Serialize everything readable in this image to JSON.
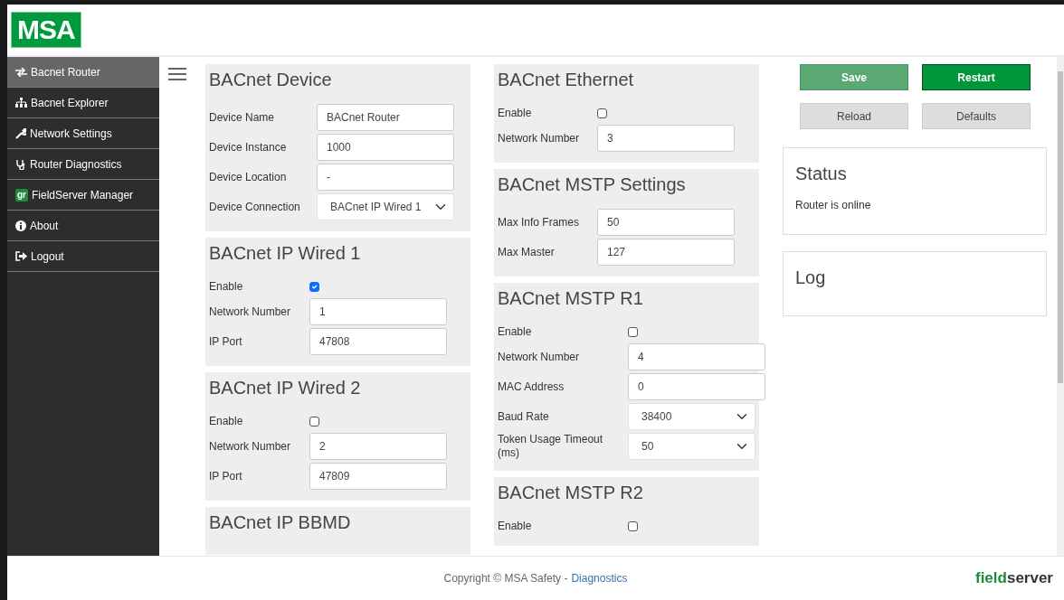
{
  "header": {
    "logo": "MSA"
  },
  "sidebar": {
    "items": [
      {
        "label": "Bacnet Router",
        "selected": true
      },
      {
        "label": "Bacnet Explorer",
        "selected": false
      },
      {
        "label": "Network Settings",
        "selected": false
      },
      {
        "label": "Router Diagnostics",
        "selected": false
      },
      {
        "label": "FieldServer Manager",
        "selected": false,
        "badge": "gr"
      },
      {
        "label": "About",
        "selected": false
      },
      {
        "label": "Logout",
        "selected": false
      }
    ]
  },
  "columns": [
    [
      {
        "title": "BACnet Device",
        "fields": [
          {
            "label": "Device Name",
            "kind": "text",
            "value": "BACnet Router"
          },
          {
            "label": "Device Instance",
            "kind": "text",
            "value": "1000"
          },
          {
            "label": "Device Location",
            "kind": "text",
            "value": "-"
          },
          {
            "label": "Device Connection",
            "kind": "select",
            "value": "BACnet IP Wired 1"
          }
        ]
      },
      {
        "title": "BACnet IP Wired 1",
        "fields": [
          {
            "label": "Enable",
            "kind": "checkbox",
            "checked": true
          },
          {
            "label": "Network Number",
            "kind": "text",
            "value": "1"
          },
          {
            "label": "IP Port",
            "kind": "text",
            "value": "47808"
          }
        ]
      },
      {
        "title": "BACnet IP Wired 2",
        "fields": [
          {
            "label": "Enable",
            "kind": "checkbox",
            "checked": false
          },
          {
            "label": "Network Number",
            "kind": "text",
            "value": "2"
          },
          {
            "label": "IP Port",
            "kind": "text",
            "value": "47809"
          }
        ]
      },
      {
        "title": "BACnet IP BBMD"
      }
    ],
    [
      {
        "title": "BACnet Ethernet",
        "fields": [
          {
            "label": "Enable",
            "kind": "checkbox",
            "checked": false
          },
          {
            "label": "Network Number",
            "kind": "text",
            "value": "3"
          }
        ]
      },
      {
        "title": "BACnet MSTP Settings",
        "fields": [
          {
            "label": "Max Info Frames",
            "kind": "text",
            "value": "50"
          },
          {
            "label": "Max Master",
            "kind": "text",
            "value": "127"
          }
        ]
      },
      {
        "title": "BACnet MSTP R1",
        "fields": [
          {
            "label": "Enable",
            "kind": "checkbox",
            "checked": false
          },
          {
            "label": "Network Number",
            "kind": "text",
            "value": "4"
          },
          {
            "label": "MAC Address",
            "kind": "text",
            "value": "0"
          },
          {
            "label": "Baud Rate",
            "kind": "select",
            "value": "38400"
          },
          {
            "label": "Token Usage Timeout (ms)",
            "kind": "select",
            "value": "50"
          }
        ]
      },
      {
        "title": "BACnet MSTP R2",
        "fields": [
          {
            "label": "Enable",
            "kind": "checkbox",
            "checked": false
          }
        ]
      }
    ]
  ],
  "buttons": [
    {
      "label": "Save"
    },
    {
      "label": "Restart"
    },
    {
      "label": "Reload"
    },
    {
      "label": "Defaults"
    }
  ],
  "status": {
    "title": "Status",
    "text": "Router is online"
  },
  "log": {
    "title": "Log"
  },
  "footer": {
    "copyright": "Copyright © MSA Safety -",
    "link": "Diagnostics",
    "brand_field": "field",
    "brand_server": "server"
  }
}
